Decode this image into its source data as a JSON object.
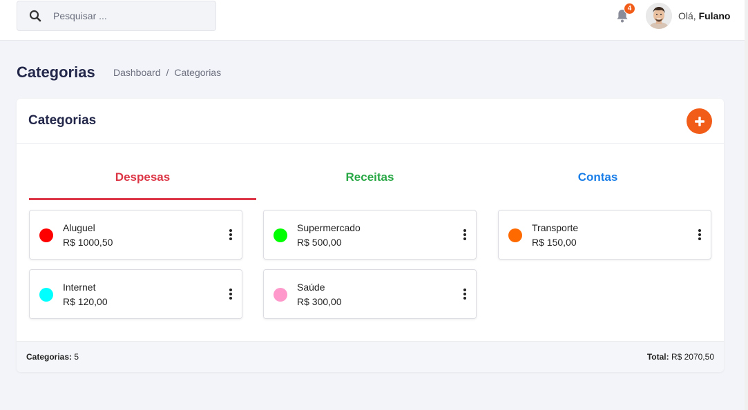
{
  "search": {
    "placeholder": "Pesquisar ..."
  },
  "notifications": {
    "count": "4"
  },
  "user": {
    "greeting": "Olá,",
    "name": "Fulano"
  },
  "page": {
    "title": "Categorias",
    "breadcrumb": [
      "Dashboard",
      "/",
      "Categorias"
    ]
  },
  "card": {
    "title": "Categorias",
    "tabs": [
      {
        "label": "Despesas",
        "color": "#dc3545",
        "active": true
      },
      {
        "label": "Receitas",
        "color": "#28a745",
        "active": false
      },
      {
        "label": "Contas",
        "color": "#1a7ee8",
        "active": false
      }
    ],
    "categories": [
      {
        "name": "Aluguel",
        "value": "R$ 1000,50",
        "color": "#ff0000"
      },
      {
        "name": "Supermercado",
        "value": "R$ 500,00",
        "color": "#00ff00"
      },
      {
        "name": "Transporte",
        "value": "R$ 150,00",
        "color": "#ff6a00"
      },
      {
        "name": "Internet",
        "value": "R$ 120,00",
        "color": "#00ffff"
      },
      {
        "name": "Saúde",
        "value": "R$ 300,00",
        "color": "#ff99cc"
      }
    ],
    "footer": {
      "count_label": "Categorias:",
      "count": "5",
      "total_label": "Total:",
      "total": "R$ 2070,50"
    }
  },
  "colors": {
    "accent": "#f25c19",
    "title": "#23284b"
  }
}
